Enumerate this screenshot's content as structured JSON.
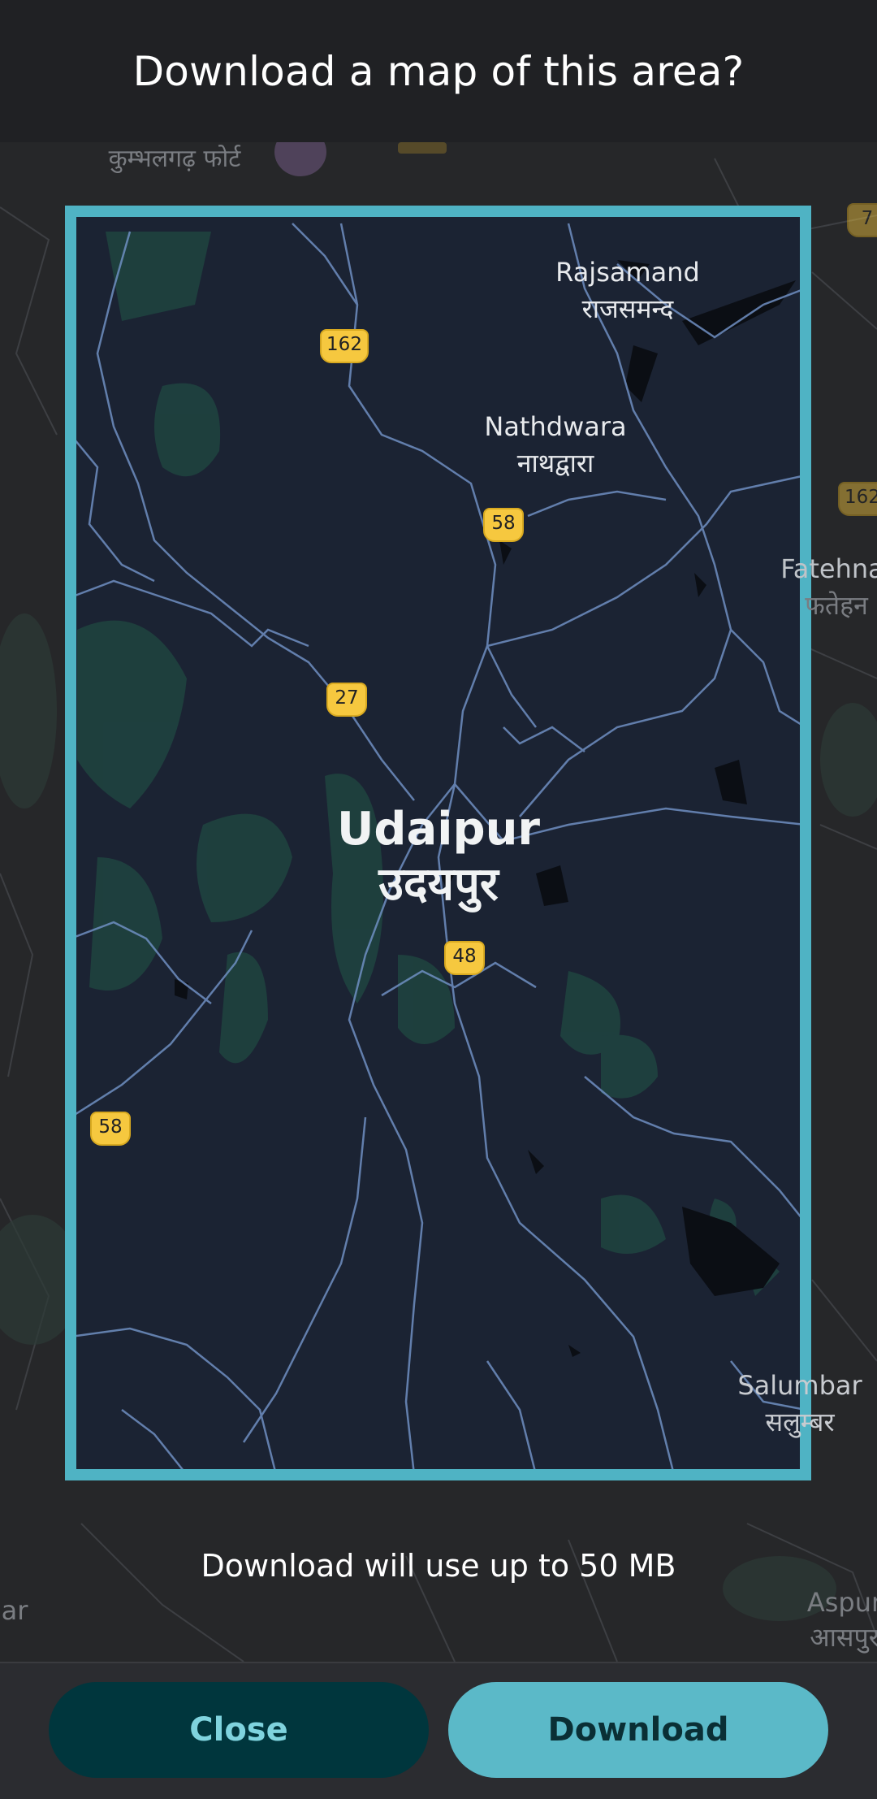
{
  "dialog": {
    "title": "Download a map of this area?",
    "size_note": "Download will use up to 50 MB"
  },
  "buttons": {
    "close_label": "Close",
    "download_label": "Download"
  },
  "map": {
    "selection_color": "#4fb3c4",
    "labels": {
      "kumbhalgarh": "कुम्भलगढ़ फोर्ट",
      "rajsamand_en": "Rajsamand",
      "rajsamand_hi": "राजसमन्द",
      "nathdwara_en": "Nathdwara",
      "nathdwara_hi": "नाथद्वारा",
      "udaipur_en": "Udaipur",
      "udaipur_hi": "उदयपुर",
      "fatehnagar_en": "Fatehna",
      "fatehnagar_hi": "फतेहन",
      "salumbar_en": "Salumbar",
      "salumbar_hi": "सलुम्बर",
      "aspur_en": "Aspur",
      "aspur_hi": "आसपुर",
      "left_edge_en": "ar"
    },
    "shields": {
      "nh162_top": "162",
      "nh58_north": "58",
      "nh27": "27",
      "nh48": "48",
      "nh58_west": "58",
      "edge_162": "162",
      "edge_7": "7"
    }
  }
}
